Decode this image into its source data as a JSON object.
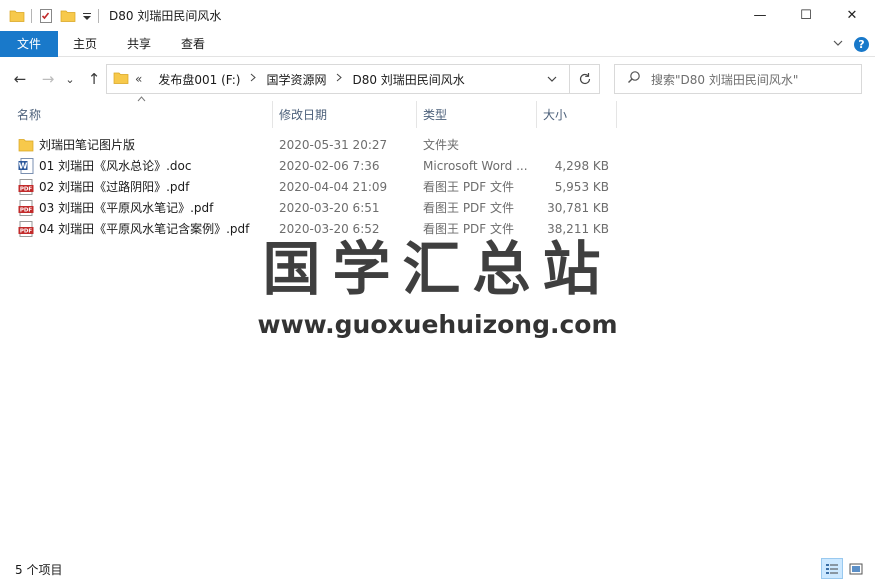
{
  "window": {
    "title": "D80 刘瑞田民间风水",
    "controls": {
      "minimize": "—",
      "maximize": "☐",
      "close": "✕"
    }
  },
  "ribbon": {
    "tabs": [
      {
        "label": "文件",
        "active": true
      },
      {
        "label": "主页"
      },
      {
        "label": "共享"
      },
      {
        "label": "查看"
      }
    ],
    "help_label": "?"
  },
  "nav": {
    "back": "←",
    "forward": "→",
    "recent": "⌄",
    "up": "↑",
    "breadcrumb": {
      "overflow": "«",
      "items": [
        "发布盘001 (F:)",
        "国学资源网",
        "D80 刘瑞田民间风水"
      ]
    },
    "search_placeholder": "搜索\"D80 刘瑞田民间风水\""
  },
  "columns": {
    "name": "名称",
    "date": "修改日期",
    "type": "类型",
    "size": "大小"
  },
  "files": [
    {
      "name": "刘瑞田笔记图片版",
      "date": "2020-05-31 20:27",
      "type": "文件夹",
      "size": "",
      "icon": "folder-icon"
    },
    {
      "name": "01 刘瑞田《风水总论》.doc",
      "date": "2020-02-06 7:36",
      "type": "Microsoft Word ...",
      "size": "4,298 KB",
      "icon": "word-doc-icon"
    },
    {
      "name": "02 刘瑞田《过路阴阳》.pdf",
      "date": "2020-04-04 21:09",
      "type": "看图王 PDF 文件",
      "size": "5,953 KB",
      "icon": "pdf-icon"
    },
    {
      "name": "03 刘瑞田《平原风水笔记》.pdf",
      "date": "2020-03-20 6:51",
      "type": "看图王 PDF 文件",
      "size": "30,781 KB",
      "icon": "pdf-icon"
    },
    {
      "name": "04 刘瑞田《平原风水笔记含案例》.pdf",
      "date": "2020-03-20 6:52",
      "type": "看图王 PDF 文件",
      "size": "38,211 KB",
      "icon": "pdf-icon"
    }
  ],
  "watermark": {
    "title": "国学汇总站",
    "url": "www.guoxuehuizong.com"
  },
  "status": {
    "item_count": "5 个项目"
  },
  "colors": {
    "accent": "#1979ca",
    "folder": "#f7c94b",
    "pdf": "#c22b2b",
    "word": "#2b579a"
  }
}
